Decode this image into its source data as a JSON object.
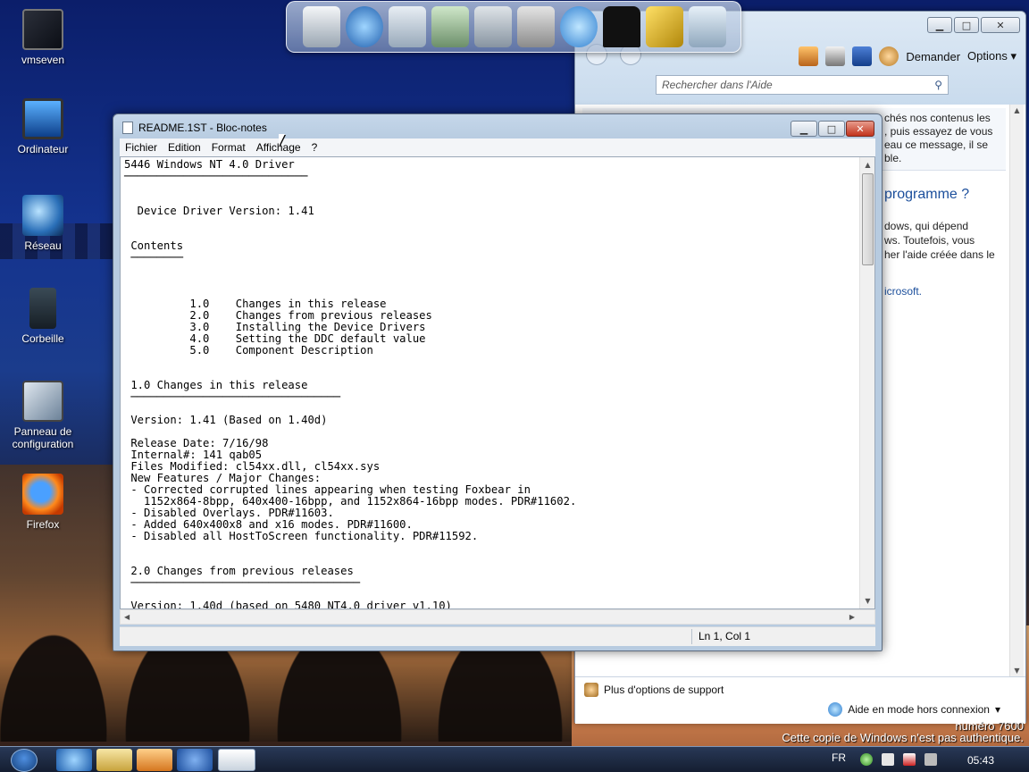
{
  "desktop": {
    "icons": [
      {
        "label": "vmseven",
        "icon": "console-icon"
      },
      {
        "label": "Ordinateur",
        "icon": "computer-icon"
      },
      {
        "label": "Réseau",
        "icon": "network-icon"
      },
      {
        "label": "Corbeille",
        "icon": "recycle-bin-icon"
      },
      {
        "label": "Panneau de configuration",
        "icon": "control-panel-icon"
      },
      {
        "label": "Firefox",
        "icon": "firefox-icon"
      }
    ],
    "watermark": {
      "line1": "numéro 7600",
      "line2": "Cette copie de Windows n'est pas authentique."
    }
  },
  "dock": {
    "items": [
      "monitor-icon",
      "web-globe-icon",
      "documents-icon",
      "folder-icon",
      "settings-icon",
      "tools-icon",
      "internet-icon",
      "shirt-icon",
      "hammer-icon",
      "recycle-icon"
    ]
  },
  "help": {
    "toolbar": {
      "ask_label": "Demander",
      "options_label": "Options"
    },
    "search": {
      "placeholder": "Rechercher dans l'Aide"
    },
    "notice_lines": [
      "chés nos contenus les",
      ", puis essayez de vous",
      "eau ce message, il se",
      "ble."
    ],
    "heading": "programme ?",
    "para_lines": [
      "dows, qui dépend",
      "ws. Toutefois, vous",
      "her l'aide créée dans le"
    ],
    "link": "icrosoft.",
    "support_label": "Plus d'options de support",
    "offline_label": "Aide en mode hors connexion"
  },
  "notepad": {
    "title": "README.1ST - Bloc-notes",
    "menus": [
      "Fichier",
      "Edition",
      "Format",
      "Affichage",
      "?"
    ],
    "content": "5446 Windows NT 4.0 Driver\n────────────────────────────\n\n\n  Device Driver Version: 1.41\n\n\n Contents\n ────────\n\n\n\n          1.0    Changes in this release\n          2.0    Changes from previous releases\n          3.0    Installing the Device Drivers\n          4.0    Setting the DDC default value\n          5.0    Component Description\n\n\n 1.0 Changes in this release\n ────────────────────────────────\n\n Version: 1.41 (Based on 1.40d)\n\n Release Date: 7/16/98\n Internal#: 141 qab05\n Files Modified: cl54xx.dll, cl54xx.sys\n New Features / Major Changes:\n - Corrected corrupted lines appearing when testing Foxbear in\n   1152x864-8bpp, 640x400-16bpp, and 1152x864-16bpp modes. PDR#11602.\n - Disabled Overlays. PDR#11603.\n - Added 640x400x8 and x16 modes. PDR#11600.\n - Disabled all HostToScreen functionality. PDR#11592.\n\n\n 2.0 Changes from previous releases\n ───────────────────────────────────\n\n Version: 1.40d (based on 5480 NT4.0 driver v1.10)",
    "status": "Ln 1, Col 1"
  },
  "taskbar": {
    "buttons": [
      "internet-explorer-icon",
      "explorer-icon",
      "media-player-icon",
      "help-icon",
      "notepad-icon"
    ],
    "language": "FR",
    "clock": "05:43"
  }
}
